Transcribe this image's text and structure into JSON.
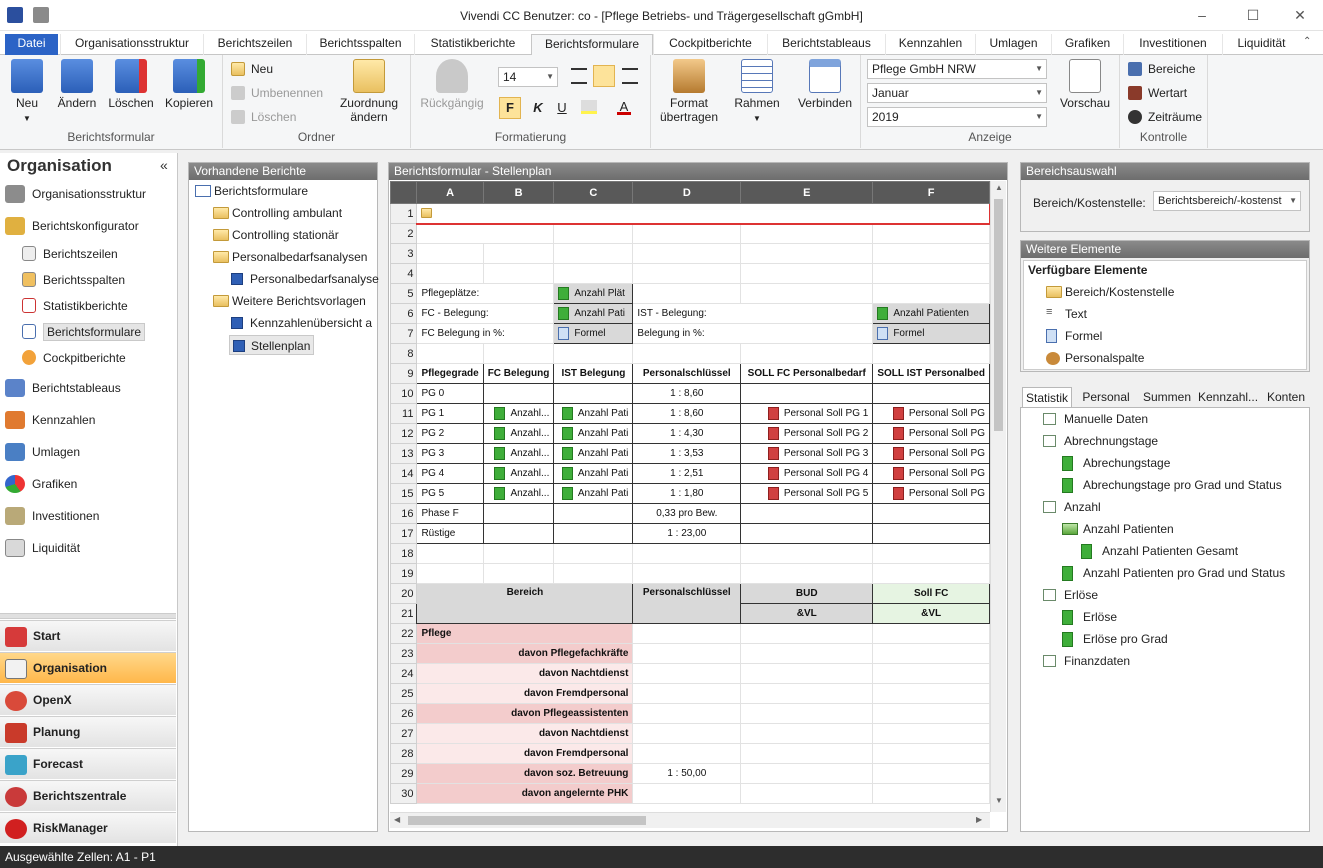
{
  "window": {
    "title": "Vivendi CC  Benutzer: co - [Pflege Betriebs- und Trägergesellschaft gGmbH]"
  },
  "tabs": [
    "Datei",
    "Organisationsstruktur",
    "Berichtszeilen",
    "Berichtsspalten",
    "Statistikberichte",
    "Berichtsformulare",
    "Cockpitberichte",
    "Berichtstableaus",
    "Kennzahlen",
    "Umlagen",
    "Grafiken",
    "Investitionen",
    "Liquidität"
  ],
  "ribbon": {
    "berichtsformular": {
      "label": "Berichtsformular",
      "neu": "Neu",
      "aendern": "Ändern",
      "loeschen": "Löschen",
      "kopieren": "Kopieren"
    },
    "ordner": {
      "label": "Ordner",
      "neu": "Neu",
      "umbenennen": "Umbenennen",
      "loeschen": "Löschen",
      "zuordnung1": "Zuordnung",
      "zuordnung2": "ändern"
    },
    "formatierung": {
      "label": "Formatierung",
      "rueckgaengig": "Rückgängig",
      "fontsize": "14",
      "bold": "F",
      "italic": "K",
      "underline": "U",
      "format1": "Format",
      "format2": "übertragen",
      "rahmen": "Rahmen",
      "verbinden": "Verbinden"
    },
    "anzeige": {
      "label": "Anzeige",
      "org": "Pflege GmbH NRW",
      "monat": "Januar",
      "jahr": "2019",
      "vorschau": "Vorschau"
    },
    "kontrolle": {
      "label": "Kontrolle",
      "bereiche": "Bereiche",
      "wertart": "Wertart",
      "zeitraeume": "Zeiträume"
    }
  },
  "left": {
    "title": "Organisation",
    "collapse": "«",
    "items": [
      "Organisationsstruktur",
      "Berichtskonfigurator",
      "Berichtszeilen",
      "Berichtsspalten",
      "Statistikberichte",
      "Berichtsformulare",
      "Cockpitberichte",
      "Berichtstableaus",
      "Kennzahlen",
      "Umlagen",
      "Grafiken",
      "Investitionen",
      "Liquidität"
    ],
    "bottom": [
      "Start",
      "Organisation",
      "OpenX",
      "Planung",
      "Forecast",
      "Berichtszentrale",
      "RiskManager"
    ]
  },
  "reports": {
    "title": "Vorhandene Berichte",
    "root": "Berichtsformulare",
    "items": [
      "Controlling ambulant",
      "Controlling stationär",
      "Personalbedarfsanalysen",
      "Personalbedarfsanalyse",
      "Weitere Berichtsvorlagen",
      "Kennzahlenübersicht a",
      "Stellenplan"
    ]
  },
  "sheet": {
    "title": "Berichtsformular - Stellenplan",
    "cols": [
      "A",
      "B",
      "C",
      "D",
      "E",
      "F"
    ],
    "r5": {
      "a": "Pflegeplätze:",
      "c": "Anzahl Plät"
    },
    "r6": {
      "a": "FC - Belegung:",
      "c": "Anzahl Pati",
      "d": "IST - Belegung:",
      "f": "Anzahl Patienten"
    },
    "r7": {
      "a": "FC Belegung in %:",
      "c": "Formel",
      "d": "Belegung in %:",
      "f": "Formel"
    },
    "r9": [
      "Pflegegrade",
      "FC Belegung",
      "IST Belegung",
      "Personalschlüssel",
      "SOLL FC Personalbedarf",
      "SOLL IST Personalbed"
    ],
    "rows": [
      {
        "n": "10",
        "a": "PG 0",
        "d": "1 : 8,60"
      },
      {
        "n": "11",
        "a": "PG 1",
        "b": "Anzahl...",
        "c": "Anzahl Pati",
        "d": "1 : 8,60",
        "e": "Personal Soll PG 1",
        "f": "Personal Soll PG"
      },
      {
        "n": "12",
        "a": "PG 2",
        "b": "Anzahl...",
        "c": "Anzahl Pati",
        "d": "1 : 4,30",
        "e": "Personal Soll PG 2",
        "f": "Personal Soll PG"
      },
      {
        "n": "13",
        "a": "PG 3",
        "b": "Anzahl...",
        "c": "Anzahl Pati",
        "d": "1 : 3,53",
        "e": "Personal Soll PG 3",
        "f": "Personal Soll PG"
      },
      {
        "n": "14",
        "a": "PG 4",
        "b": "Anzahl...",
        "c": "Anzahl Pati",
        "d": "1 : 2,51",
        "e": "Personal Soll PG 4",
        "f": "Personal Soll PG"
      },
      {
        "n": "15",
        "a": "PG 5",
        "b": "Anzahl...",
        "c": "Anzahl Pati",
        "d": "1 : 1,80",
        "e": "Personal Soll PG 5",
        "f": "Personal Soll PG"
      },
      {
        "n": "16",
        "a": "Phase F",
        "d": "0,33 pro Bew."
      },
      {
        "n": "17",
        "a": "Rüstige",
        "d": "1 : 23,00"
      }
    ],
    "r20": {
      "bereich": "Bereich",
      "pers": "Personalschlüssel",
      "bud": "BUD",
      "sollfc": "Soll FC"
    },
    "r21": {
      "e": "&VL",
      "f": "&VL"
    },
    "lower": [
      {
        "n": "22",
        "a": "Pflege"
      },
      {
        "n": "23",
        "a": "davon Pflegefachkräfte"
      },
      {
        "n": "24",
        "a": "davon Nachtdienst"
      },
      {
        "n": "25",
        "a": "davon Fremdpersonal"
      },
      {
        "n": "26",
        "a": "davon Pflegeassistenten"
      },
      {
        "n": "27",
        "a": "davon Nachtdienst"
      },
      {
        "n": "28",
        "a": "davon Fremdpersonal"
      },
      {
        "n": "29",
        "a": "davon soz. Betreuung",
        "d": "1 : 50,00"
      },
      {
        "n": "30",
        "a": "davon angelernte PHK"
      }
    ]
  },
  "bereichsauswahl": {
    "title": "Bereichsauswahl",
    "label": "Bereich/Kostenstelle:",
    "value": "Berichtsbereich/-kostenst"
  },
  "weitere": {
    "title": "Weitere Elemente",
    "header": "Verfügbare Elemente",
    "items": [
      "Bereich/Kostenstelle",
      "Text",
      "Formel",
      "Personalspalte"
    ]
  },
  "stat": {
    "tabs": [
      "Statistik",
      "Personal",
      "Summen",
      "Kennzahl...",
      "Konten"
    ],
    "items": [
      "Manuelle Daten",
      "Abrechnungstage",
      "Abrechungstage",
      "Abrechungstage pro Grad und Status",
      "Anzahl",
      "Anzahl Patienten",
      "Anzahl Patienten Gesamt",
      "Anzahl Patienten pro Grad und Status",
      "Erlöse",
      "Erlöse",
      "Erlöse pro Grad",
      "Finanzdaten"
    ]
  },
  "status": "Ausgewählte Zellen: A1 - P1",
  "colors": {
    "accent": "#2b63c6",
    "active_nav": "#ffb74a",
    "header_dark": "#595959"
  }
}
